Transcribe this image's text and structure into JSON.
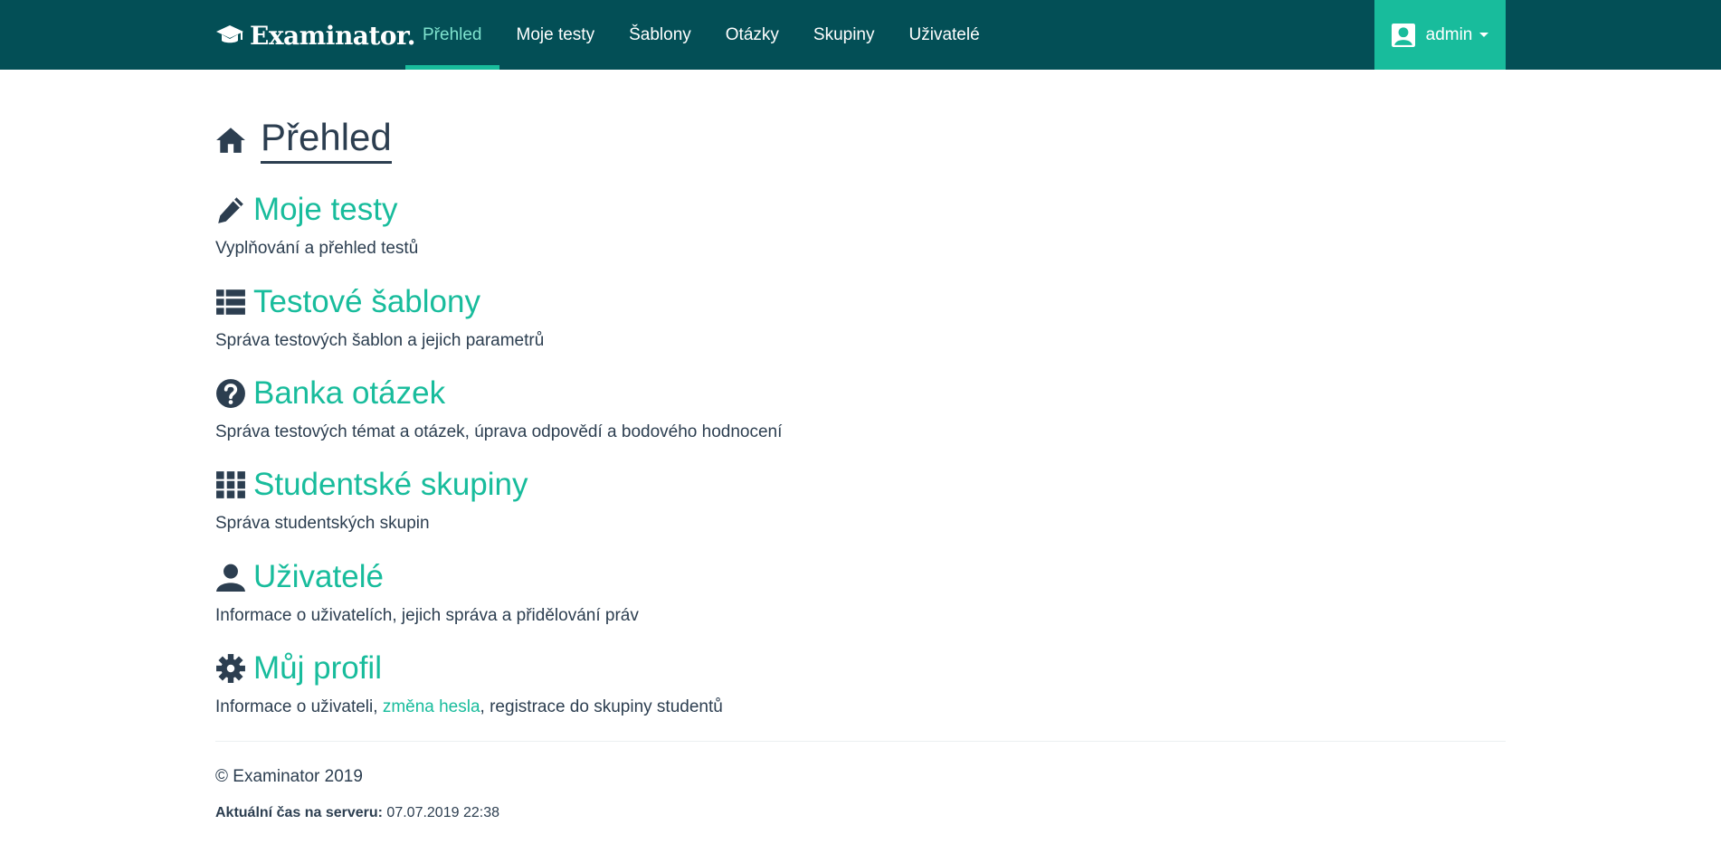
{
  "brand": {
    "name": "Examinator."
  },
  "nav": [
    {
      "label": "Přehled",
      "active": true
    },
    {
      "label": "Moje testy"
    },
    {
      "label": "Šablony"
    },
    {
      "label": "Otázky"
    },
    {
      "label": "Skupiny"
    },
    {
      "label": "Uživatelé"
    }
  ],
  "user_menu": {
    "label": "admin",
    "icon": "user-icon"
  },
  "page": {
    "title": "Přehled",
    "icon": "home-icon"
  },
  "sections": [
    {
      "title": "Moje testy",
      "icon": "pencil-icon",
      "desc": "Vyplňování a přehled testů"
    },
    {
      "title": "Testové šablony",
      "icon": "list-icon",
      "desc": "Správa testových šablon a jejich parametrů"
    },
    {
      "title": "Banka otázek",
      "icon": "question-circle-icon",
      "desc": "Správa testových témat a otázek, úprava odpovědí a bodového hodnocení"
    },
    {
      "title": "Studentské skupiny",
      "icon": "grid-icon",
      "desc": "Správa studentských skupin"
    },
    {
      "title": "Uživatelé",
      "icon": "user-icon",
      "desc": "Informace o uživatelích, jejich správa a přidělování práv"
    },
    {
      "title": "Můj profil",
      "icon": "gear-icon",
      "desc_before": "Informace o uživateli, ",
      "desc_link": "změna hesla",
      "desc_after": ", registrace do skupiny studentů"
    }
  ],
  "footer": {
    "copyright": "© Examinator 2019",
    "time_label": "Aktuální čas na serveru:",
    "time_value": "07.07.2019 22:38"
  },
  "colors": {
    "navbar": "#034f56",
    "accent": "#18bc9c",
    "text": "#2c3e50"
  }
}
